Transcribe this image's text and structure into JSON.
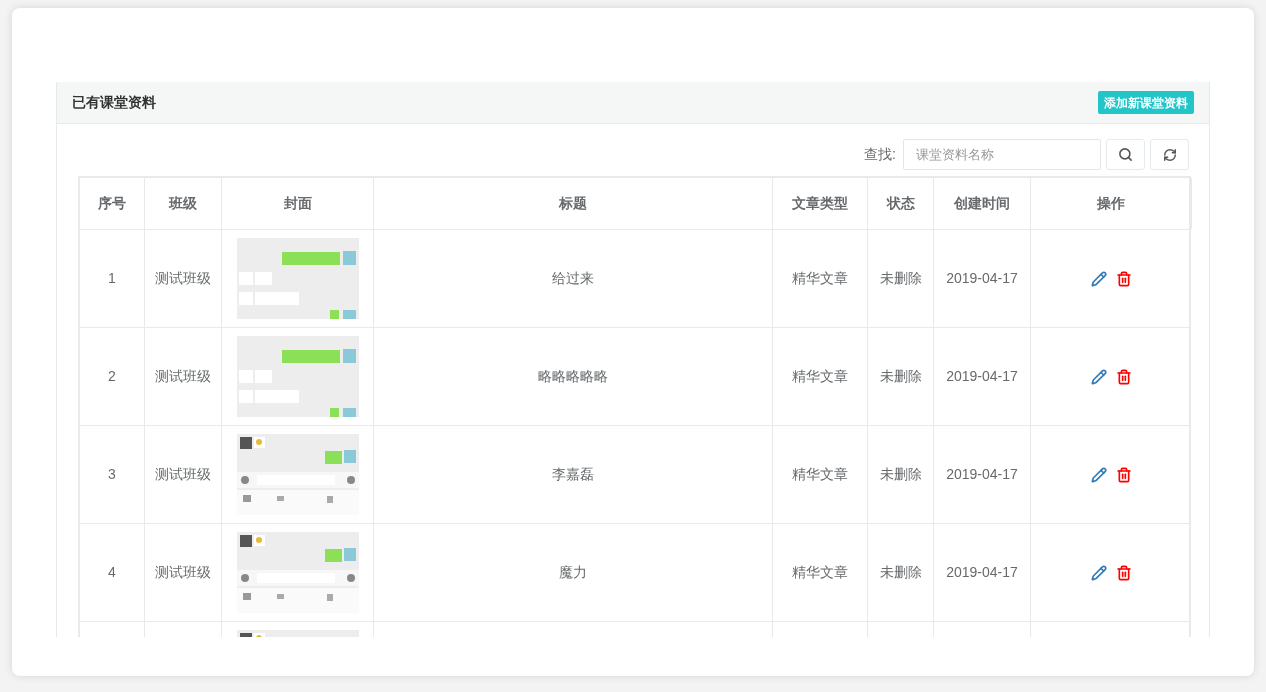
{
  "panel": {
    "title": "已有课堂资料",
    "add_button": "添加新课堂资料"
  },
  "search": {
    "label": "查找:",
    "placeholder": "课堂资料名称"
  },
  "table": {
    "columns": [
      "序号",
      "班级",
      "封面",
      "标题",
      "文章类型",
      "状态",
      "创建时间",
      "操作"
    ],
    "rows": [
      {
        "index": "1",
        "class": "测试班级",
        "cover": {
          "kind": "picture"
        },
        "title": "给过来",
        "type": "精华文章",
        "status": "未删除",
        "created": "2019-04-17"
      },
      {
        "index": "2",
        "class": "测试班级",
        "cover": {
          "kind": "picture"
        },
        "title": "略略略略略",
        "type": "精华文章",
        "status": "未删除",
        "created": "2019-04-17"
      },
      {
        "index": "3",
        "class": "测试班级",
        "cover": {
          "kind": "picture"
        },
        "title": "李嘉磊",
        "type": "精华文章",
        "status": "未删除",
        "created": "2019-04-17"
      },
      {
        "index": "4",
        "class": "测试班级",
        "cover": {
          "kind": "picture"
        },
        "title": "魔力",
        "type": "精华文章",
        "status": "未删除",
        "created": "2019-04-17"
      },
      {
        "cover": {
          "kind": "picture"
        }
      }
    ]
  }
}
